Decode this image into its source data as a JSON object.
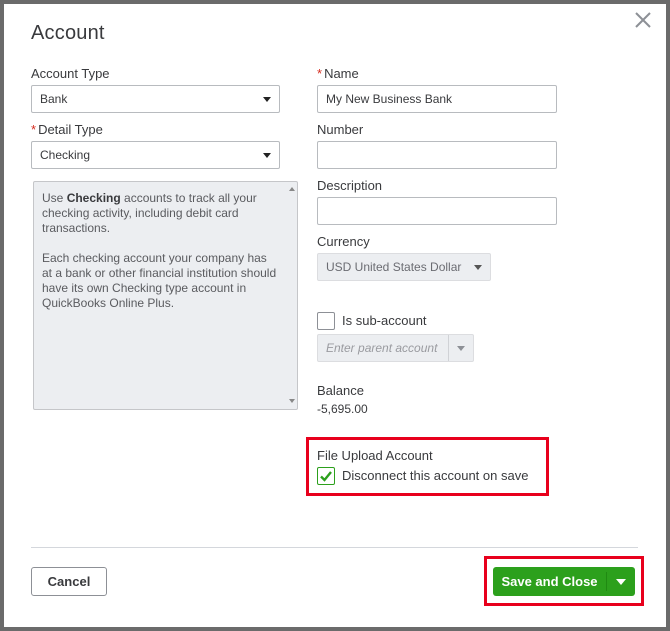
{
  "dialog": {
    "title": "Account"
  },
  "left": {
    "account_type_label": "Account Type",
    "account_type_value": "Bank",
    "detail_type_required": "*",
    "detail_type_label": "Detail Type",
    "detail_type_value": "Checking",
    "description_bold": "Checking",
    "description_pre": "Use ",
    "description_post": " accounts to track all your checking activity, including debit card transactions.",
    "description_p2": "Each checking account your company has at a bank or other financial institution should have its own Checking type account in QuickBooks Online Plus."
  },
  "right": {
    "name_required": "*",
    "name_label": "Name",
    "name_value": "My New Business Bank",
    "number_label": "Number",
    "number_value": "",
    "description_label": "Description",
    "description_value": "",
    "currency_label": "Currency",
    "currency_value": "USD United States Dollar",
    "sub_account_label": "Is sub-account",
    "parent_account_placeholder": "Enter parent account",
    "balance_label": "Balance",
    "balance_value": "-5,695.00",
    "file_upload_label": "File Upload Account",
    "disconnect_label": "Disconnect this account on save",
    "disconnect_checked": true
  },
  "footer": {
    "cancel_label": "Cancel",
    "save_label": "Save and Close"
  },
  "colors": {
    "primary_green": "#2ca01c",
    "required_red": "#d52b1e",
    "highlight_red": "#e8001c"
  }
}
